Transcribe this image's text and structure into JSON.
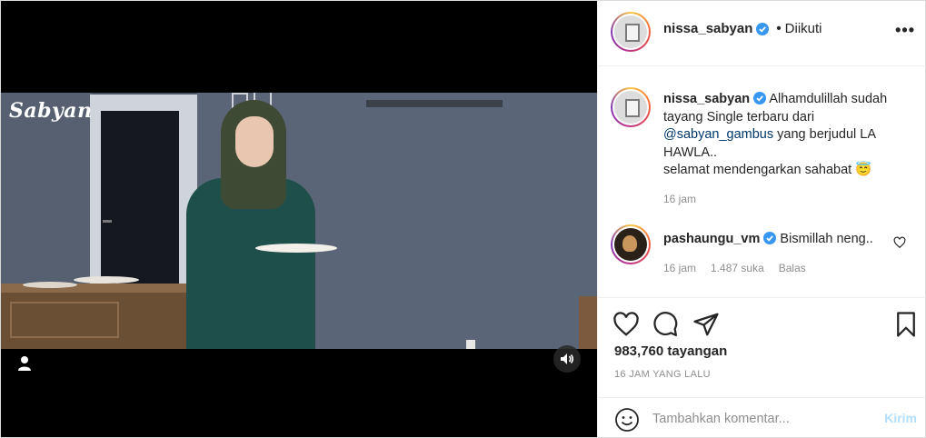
{
  "video": {
    "watermark": "Sabyan"
  },
  "header": {
    "username": "nissa_sabyan",
    "separator": "•",
    "follow_status": "Diikuti"
  },
  "caption": {
    "username": "nissa_sabyan",
    "text_before_mention": "Alhamdulillah sudah tayang Single terbaru dari",
    "mention": "@sabyan_gambus",
    "text_after_mention": "yang berjudul LA HAWLA..",
    "line_last": "selamat mendengarkan sahabat 😇",
    "time": "16 jam"
  },
  "comment": {
    "username": "pashaungu_vm",
    "text": "Bismillah neng..",
    "time": "16 jam",
    "likes": "1.487 suka",
    "reply_label": "Balas"
  },
  "stats": {
    "views": "983,760 tayangan",
    "posted_ago": "16 JAM YANG LALU"
  },
  "add_comment": {
    "placeholder": "Tambahkan komentar...",
    "post_label": "Kirim"
  },
  "colors": {
    "verified": "#3897f0",
    "mention": "#00376b",
    "muted_text": "#8e8e8e",
    "post_disabled": "#b2dffc"
  }
}
